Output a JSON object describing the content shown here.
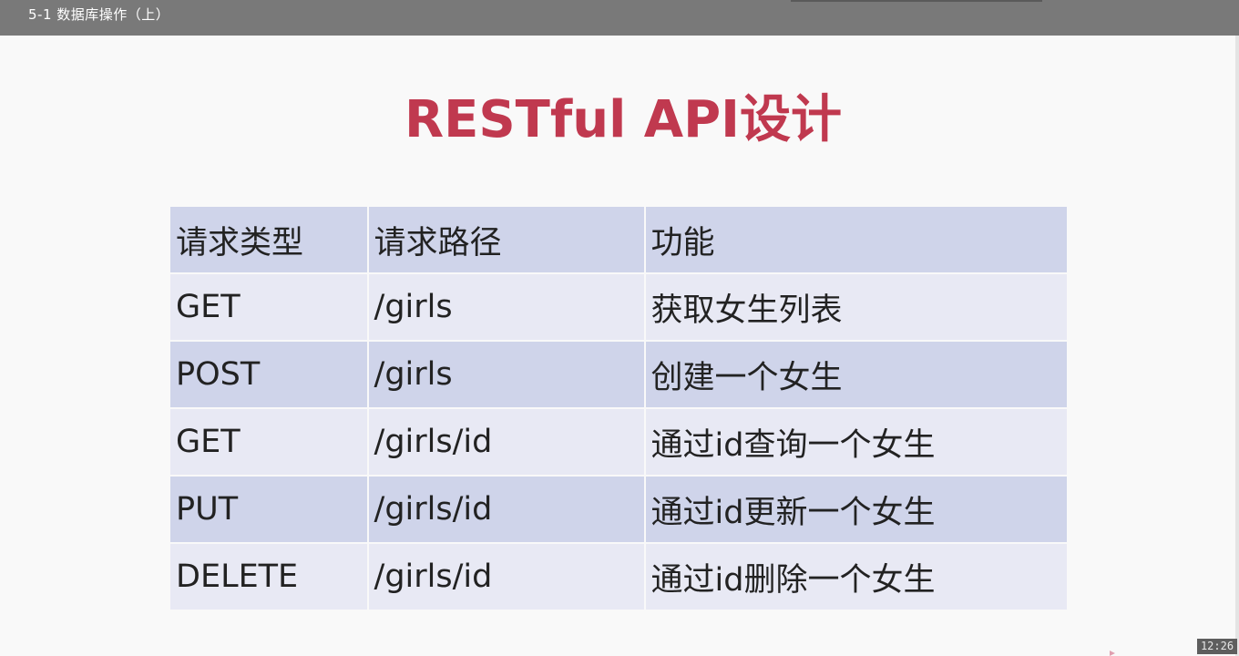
{
  "window": {
    "title": "5-1 数据库操作（上）"
  },
  "slide": {
    "title": "RESTful API设计",
    "table": {
      "headers": [
        "请求类型",
        "请求路径",
        "功能"
      ],
      "rows": [
        [
          "GET",
          "/girls",
          "获取女生列表"
        ],
        [
          "POST",
          "/girls",
          "创建一个女生"
        ],
        [
          "GET",
          "/girls/id",
          "通过id查询一个女生"
        ],
        [
          "PUT",
          "/girls/id",
          "通过id更新一个女生"
        ],
        [
          "DELETE",
          "/girls/id",
          "通过id删除一个女生"
        ]
      ]
    }
  },
  "player": {
    "time": "12:26"
  },
  "colors": {
    "title": "#c0394f",
    "row_dark": "#cfd4ea",
    "row_light": "#e8e9f4",
    "topbar": "#797979"
  }
}
